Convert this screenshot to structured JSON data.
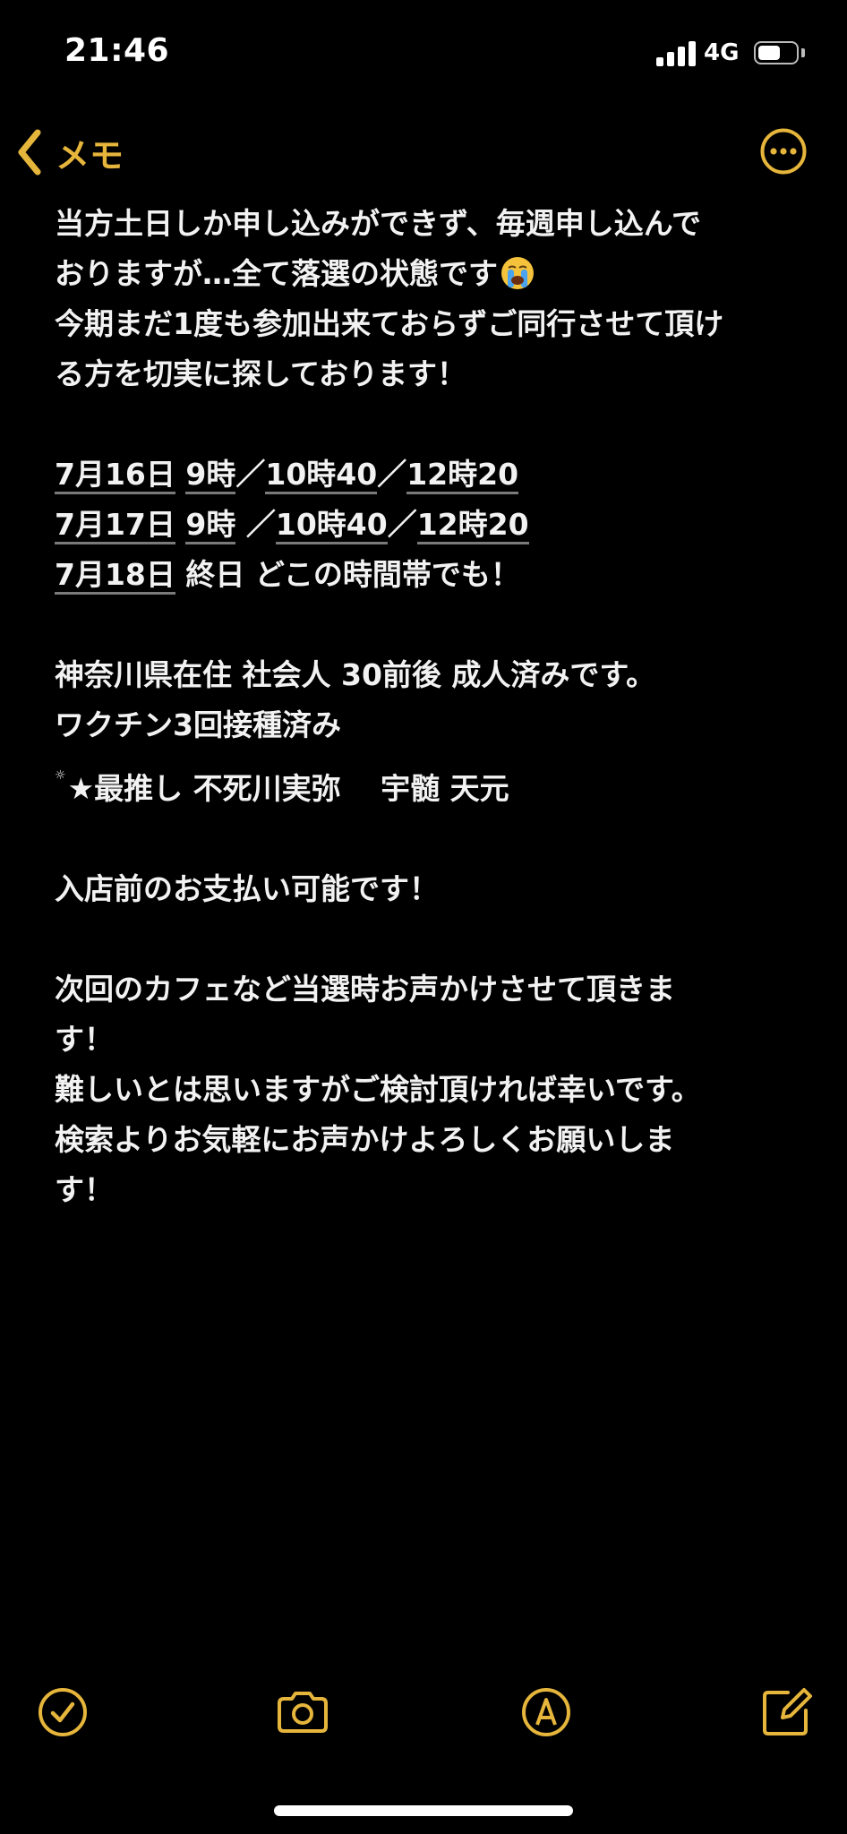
{
  "status_bar": {
    "time": "21:46",
    "network": "4G",
    "battery_level": 0.6
  },
  "nav": {
    "back_label": "メモ",
    "back_icon": "chevron-left-icon",
    "more_icon": "ellipsis-circle-icon"
  },
  "note": {
    "line1": "当方土日しか申し込みができず、毎週申し込んで",
    "line2": "おりますが…全て落選の状態です",
    "line3": "今期まだ1度も参加出来ておらずご同行させて頂け",
    "line4": "る方を切実に探しております！",
    "sched1_date": "7月16日",
    "sched1_t1": "9時",
    "sched1_sep1": "／",
    "sched1_t2": "10時40",
    "sched1_sep2": "／",
    "sched1_t3": "12時20",
    "sched2_date": "7月17日",
    "sched2_t1": "9時",
    "sched2_sep1": "／",
    "sched2_t2": "10時40",
    "sched2_sep2": "／",
    "sched2_t3": "12時20",
    "sched3_date": "7月18日",
    "sched3_rest": "終日 どこの時間帯でも！",
    "profile1": "神奈川県在住 社会人 30前後 成人済みです。",
    "profile2": "ワクチン3回接種済み",
    "profile3_star_small": "☼",
    "profile3": "★最推し 不死川実弥　 宇髄 天元",
    "payment": "入店前のお支払い可能です！",
    "closing1": "次回のカフェなど当選時お声かけさせて頂きま",
    "closing2": "す！",
    "closing3": "難しいとは思いますがご検討頂ければ幸いです。",
    "closing4": "検索よりお気軽にお声かけよろしくお願いしま",
    "closing5": "す！"
  },
  "toolbar": {
    "items": [
      "checklist-icon",
      "camera-icon",
      "markup-pen-icon",
      "compose-icon"
    ]
  },
  "colors": {
    "accent": "#e6b53b",
    "background": "#000000",
    "text": "#f2f2f2"
  }
}
